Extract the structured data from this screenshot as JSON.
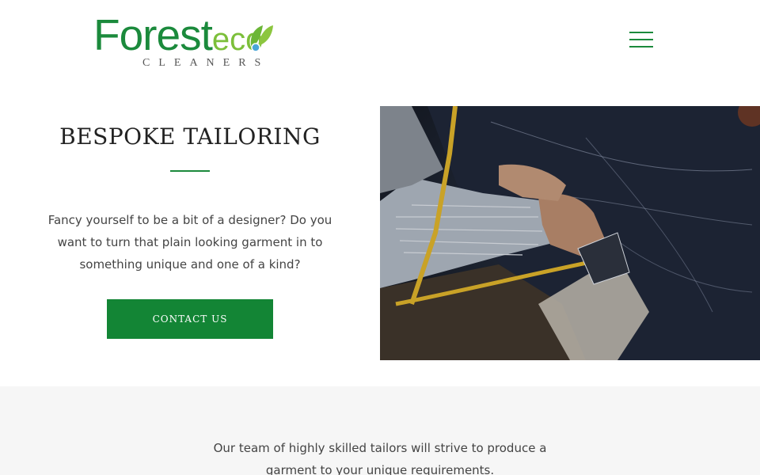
{
  "header": {
    "logo": {
      "brand": "Forest",
      "brand_suffix": "eco",
      "subtitle": "CLEANERS"
    },
    "menu_icon": "hamburger-menu-icon"
  },
  "intro": {
    "title": "BESPOKE TAILORING",
    "body": "Fancy yourself to be a bit of a designer? Do you want to turn that plain looking garment in to something unique and one of a kind?",
    "cta_label": "CONTACT US"
  },
  "photo": {
    "subject": "tailor-hands-cutting-fabric-image"
  },
  "band": {
    "text": "Our team of highly skilled tailors will strive to produce a garment to your unique requirements."
  },
  "colors": {
    "accent": "#1b8a3c",
    "button": "#138535",
    "band_bg": "#f6f6f6"
  }
}
